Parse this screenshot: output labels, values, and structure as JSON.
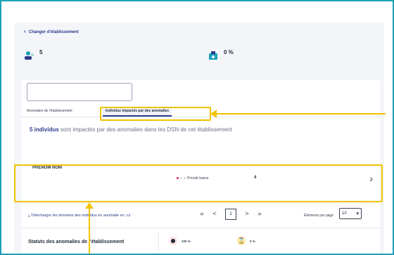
{
  "page": {
    "back_link": "Changer d'établissement",
    "stat_individuals": {
      "value": "5",
      "caption": ""
    },
    "stat_percent": {
      "value": "0 %",
      "caption": ""
    }
  },
  "search": {
    "placeholder": "",
    "secondary": ""
  },
  "tabs": [
    {
      "label": "Anomalies de l'établissement"
    },
    {
      "label": "Individus impactés par des anomalies",
      "active": true
    }
  ],
  "summary": {
    "count_text": "5 individus",
    "rest": " sont impactés par des anomalies dans les DSN de cet établissement"
  },
  "columns": [
    {
      "label": ""
    },
    {
      "label": ""
    },
    {
      "label": ""
    }
  ],
  "row": {
    "name": "PRÉNOM NOM",
    "sub": [
      "",
      "",
      ""
    ],
    "priority": "Priorité basse",
    "count": "4"
  },
  "download": {
    "label": "Télécharger les données des individus en anomalie en .cs"
  },
  "pager": {
    "current": "1",
    "first": "«",
    "prev": "<",
    "next": ">",
    "last": "»"
  },
  "per_page": {
    "label": "Éléments par page",
    "value": "10"
  },
  "status": {
    "title": "Statuts des anomalies de l'établissement",
    "a": {
      "value": "100 %",
      "text": ""
    },
    "b": {
      "value": "0 %",
      "text": ""
    }
  },
  "colors": {
    "accent": "#2b3a8c",
    "highlight": "#f2c200",
    "frame": "#1aa0b8"
  }
}
